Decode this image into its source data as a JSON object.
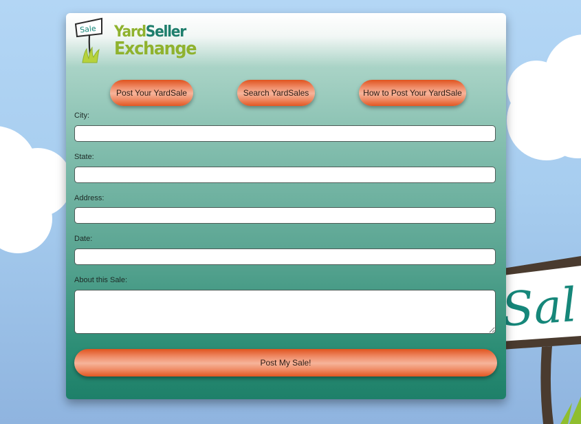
{
  "brand": {
    "logo_sign_text": "Sale",
    "name_part1": "Yard",
    "name_part2": "Seller",
    "name_line2": "Exchange"
  },
  "nav": [
    {
      "label": "Post Your YardSale"
    },
    {
      "label": "Search YardSales"
    },
    {
      "label": "How to Post Your YardSale"
    }
  ],
  "form": {
    "city_label": "City:",
    "state_label": "State:",
    "address_label": "Address:",
    "date_label": "Date:",
    "about_label": "About this Sale:",
    "city_value": "",
    "state_value": "",
    "address_value": "",
    "date_value": "",
    "about_value": "",
    "submit_label": "Post My Sale!"
  },
  "background": {
    "sign_text": "Sal"
  },
  "colors": {
    "brand_green": "#8fb22e",
    "brand_teal": "#1e7e6c",
    "button_orange": "#e25722"
  }
}
